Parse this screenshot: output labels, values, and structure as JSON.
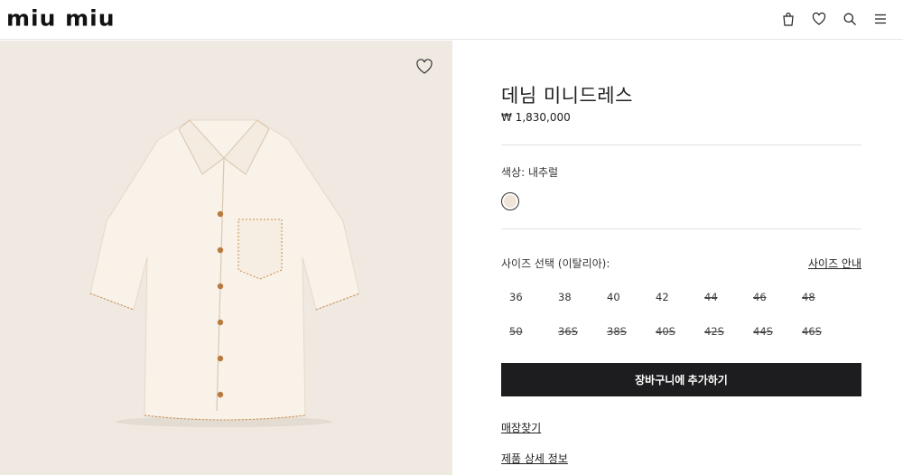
{
  "header": {
    "logo": "miu miu",
    "icons": [
      "bag-icon",
      "heart-icon",
      "search-icon",
      "menu-icon"
    ]
  },
  "product": {
    "title": "데님 미니드레스",
    "price": "₩ 1,830,000",
    "color_label": "색상:  내추럴",
    "swatch_color": "#efe4d6",
    "size_label": "사이즈 선택 (이탈리아):",
    "size_guide": "사이즈 안내",
    "sizes": [
      {
        "label": "36",
        "available": true
      },
      {
        "label": "38",
        "available": true
      },
      {
        "label": "40",
        "available": true
      },
      {
        "label": "42",
        "available": true
      },
      {
        "label": "44",
        "available": false
      },
      {
        "label": "46",
        "available": false
      },
      {
        "label": "48",
        "available": false
      },
      {
        "label": "50",
        "available": false
      },
      {
        "label": "36S",
        "available": false
      },
      {
        "label": "38S",
        "available": false
      },
      {
        "label": "40S",
        "available": false
      },
      {
        "label": "42S",
        "available": false
      },
      {
        "label": "44S",
        "available": false
      },
      {
        "label": "46S",
        "available": false
      }
    ],
    "add_to_cart": "장바구니에 추가하기",
    "store_finder": "매장찾기",
    "product_details": "제품 상세 정보"
  },
  "colors": {
    "image_background": "#efe9e2",
    "button": "#1d1d1f",
    "shirt": "#f7f0e6",
    "stitch": "#c98a4a"
  }
}
